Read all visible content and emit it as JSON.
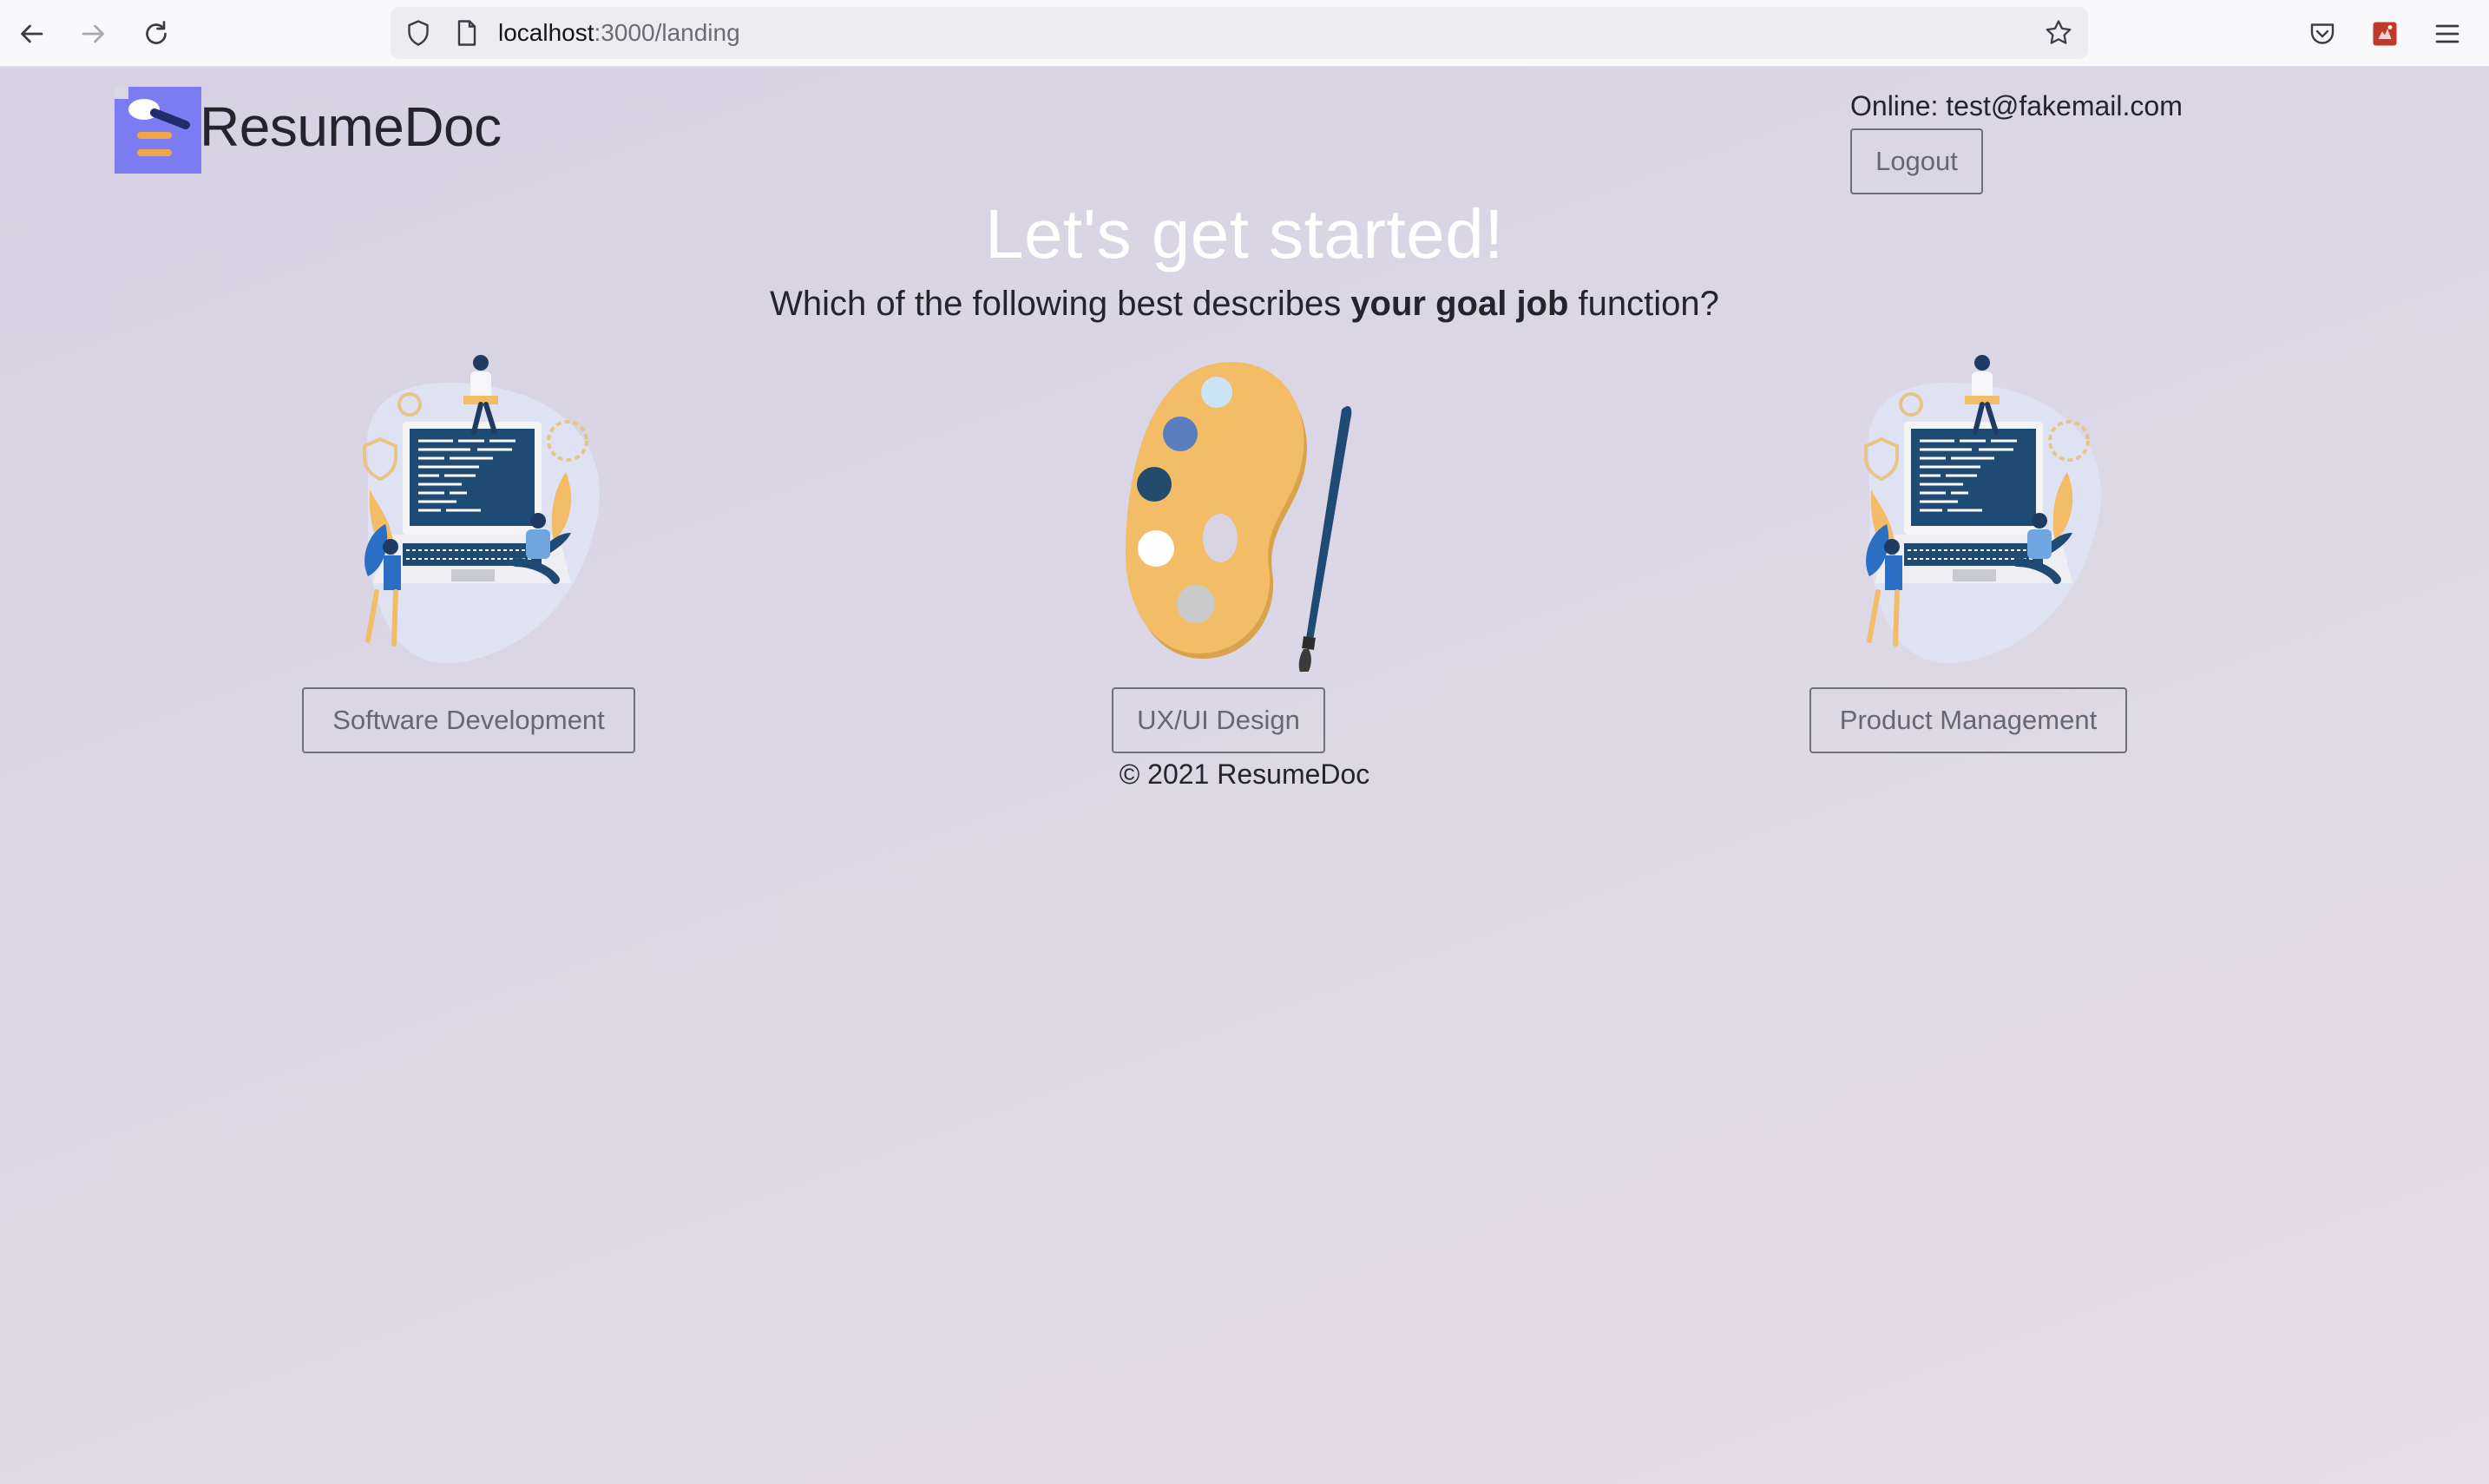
{
  "browser": {
    "url_host": "localhost",
    "url_path": ":3000/landing",
    "icons": [
      "back-arrow-icon",
      "forward-arrow-icon",
      "reload-icon",
      "shield-icon",
      "page-icon",
      "bookmark-star-icon",
      "pocket-icon",
      "extension-icon",
      "menu-icon"
    ]
  },
  "header": {
    "brand": "ResumeDoc",
    "online_status": "Online: test@fakemail.com",
    "logout_label": "Logout"
  },
  "main": {
    "title": "Let's get started!",
    "question_prefix": "Which of the following best describes ",
    "question_bold": "your goal job",
    "question_suffix": " function?",
    "options": [
      {
        "label": "Software Development",
        "illustration": "developers-laptop-illustration"
      },
      {
        "label": "UX/UI Design",
        "illustration": "paint-palette-illustration"
      },
      {
        "label": "Product Management",
        "illustration": "developers-laptop-illustration"
      }
    ]
  },
  "footer": {
    "copyright": "© 2021 ResumeDoc"
  },
  "colors": {
    "accent_purple": "#7a7af0",
    "palette_yellow": "#f2bd66",
    "navy": "#1f4a73",
    "heading": "#ffffff"
  }
}
